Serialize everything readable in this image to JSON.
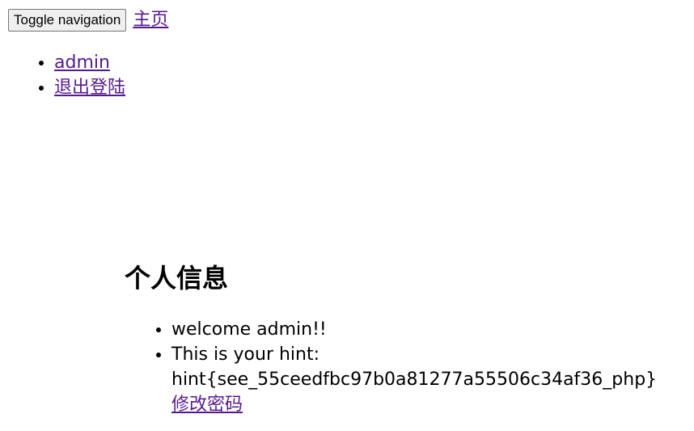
{
  "nav": {
    "toggle_label": "Toggle navigation",
    "home_label": "主页"
  },
  "user_menu": {
    "items": [
      {
        "label": "admin"
      },
      {
        "label": "退出登陆"
      }
    ]
  },
  "profile": {
    "title": "个人信息",
    "welcome": "welcome admin!!",
    "hint_prefix": "This is your hint:",
    "hint_value": "hint{see_55ceedfbc97b0a81277a55506c34af36_php}",
    "change_password_label": "修改密码"
  },
  "colors": {
    "link": "#551a8b",
    "text": "#000000",
    "background": "#ffffff"
  }
}
